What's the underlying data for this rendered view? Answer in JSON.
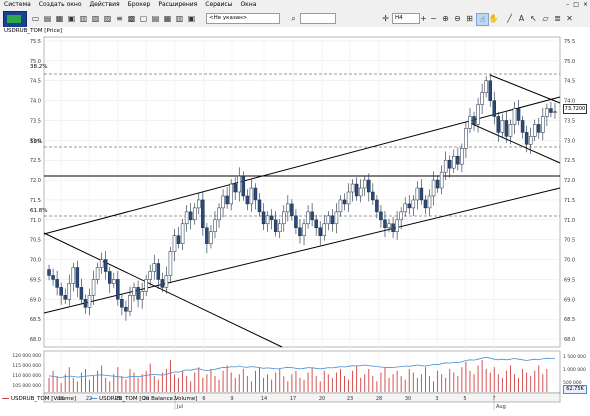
{
  "menu": [
    "Система",
    "Создать окно",
    "Действия",
    "Брокер",
    "Расширения",
    "Сервисы",
    "Окна"
  ],
  "window_controls": [
    "–",
    "□",
    "×"
  ],
  "toolbar": {
    "account_select": "<Не указан>",
    "timeframe": "H4",
    "search_placeholder": ""
  },
  "price_pane": {
    "title": "USDRUB_TOM [Price]",
    "current_price": "73.7200",
    "fib_labels": [
      "38.2%",
      "50%",
      "61.8%"
    ],
    "y_ticks": [
      "75.5",
      "75.0",
      "74.5",
      "74.0",
      "73.5",
      "73.0",
      "72.5",
      "72.0",
      "71.5",
      "71.0",
      "70.5",
      "70.0",
      "69.5",
      "69.0",
      "68.5",
      "68.0"
    ]
  },
  "volume_pane": {
    "left_ticks": [
      "120 000 000",
      "115 000 000",
      "110 000 000",
      "105 000 000"
    ],
    "right_ticks": [
      "1 500 000",
      "1 000 000",
      "500 000"
    ],
    "obv_value": "62.75K",
    "legend": [
      {
        "label": "USDRUB_TOM [Volume]",
        "color": "#d04040"
      },
      {
        "label": "USDRUB_TOM [On Balance Volume]",
        "color": "#4a90d0"
      }
    ]
  },
  "x_axis": {
    "day_labels": [
      "18",
      "22",
      "25",
      "29",
      "2",
      "6",
      "9",
      "14",
      "17",
      "20",
      "23",
      "28",
      "30",
      "3",
      "5",
      "7"
    ],
    "month_labels": [
      "Jul",
      "Aug"
    ]
  },
  "colors": {
    "up": "#ffffff",
    "down": "#2a4a7a",
    "border": "#1a2a40",
    "volume": "#d04040",
    "obv": "#4a90d0"
  },
  "chart_data": {
    "type": "candlestick",
    "title": "USDRUB_TOM [Price]",
    "ylim": [
      67.8,
      75.6
    ],
    "closes": [
      69.6,
      69.5,
      69.3,
      69.1,
      69.0,
      69.4,
      69.8,
      69.3,
      69.0,
      68.8,
      69.1,
      69.5,
      69.8,
      70.0,
      69.7,
      69.4,
      69.5,
      69.0,
      68.8,
      68.7,
      69.1,
      69.3,
      69.0,
      69.2,
      69.5,
      69.7,
      69.9,
      69.5,
      69.3,
      69.6,
      70.2,
      70.6,
      70.4,
      70.9,
      71.2,
      71.0,
      71.3,
      71.5,
      70.8,
      70.4,
      70.7,
      71.0,
      71.3,
      71.6,
      71.4,
      71.9,
      71.7,
      72.1,
      71.6,
      71.4,
      71.8,
      71.5,
      71.2,
      70.9,
      71.1,
      71.0,
      70.7,
      70.9,
      71.2,
      71.4,
      71.1,
      70.8,
      70.6,
      70.9,
      71.2,
      71.0,
      70.8,
      70.6,
      70.9,
      71.1,
      70.9,
      71.2,
      71.5,
      71.4,
      71.7,
      71.9,
      71.6,
      71.8,
      72.0,
      71.7,
      71.5,
      71.2,
      71.0,
      70.8,
      70.9,
      70.7,
      71.0,
      71.2,
      71.4,
      71.3,
      71.5,
      71.8,
      71.5,
      71.3,
      71.6,
      72.0,
      71.8,
      72.2,
      72.5,
      72.3,
      72.6,
      72.4,
      72.8,
      73.3,
      73.6,
      73.4,
      73.9,
      74.2,
      74.5,
      74.0,
      73.6,
      73.2,
      73.5,
      73.1,
      73.4,
      73.8,
      73.5,
      73.2,
      72.9,
      73.1,
      73.4,
      73.2,
      73.6,
      73.8,
      73.7,
      73.72
    ],
    "volume": [
      108,
      112,
      109,
      105,
      110,
      114,
      108,
      106,
      111,
      113,
      107,
      109,
      112,
      115,
      108,
      106,
      110,
      114,
      109,
      107,
      113,
      111,
      108,
      110,
      112,
      116,
      109,
      107,
      111,
      113,
      118,
      110,
      108,
      112,
      109,
      106,
      111,
      114,
      108,
      110,
      113,
      109,
      107,
      112,
      115,
      111,
      108,
      110,
      113,
      109,
      106,
      112,
      114,
      108,
      110,
      107,
      111,
      113,
      109,
      106,
      110,
      112,
      108,
      107,
      111,
      114,
      109,
      106,
      112,
      110,
      108,
      111,
      113,
      109,
      107,
      112,
      115,
      108,
      110,
      113,
      109,
      106,
      111,
      114,
      108,
      110,
      112,
      109,
      107,
      113,
      111,
      108,
      110,
      114,
      109,
      106,
      112,
      110,
      108,
      113,
      111,
      109,
      114,
      117,
      112,
      110,
      115,
      118,
      113,
      111,
      114,
      110,
      108,
      112,
      115,
      110,
      108,
      113,
      111,
      109,
      112,
      115,
      110,
      113
    ],
    "obv": [
      900,
      880,
      860,
      850,
      870,
      890,
      880,
      860,
      870,
      890,
      900,
      910,
      920,
      930,
      910,
      900,
      890,
      870,
      860,
      850,
      870,
      880,
      870,
      890,
      910,
      930,
      940,
      930,
      920,
      940,
      980,
      1020,
      1010,
      1050,
      1080,
      1070,
      1100,
      1120,
      1080,
      1060,
      1080,
      1100,
      1130,
      1160,
      1150,
      1180,
      1170,
      1200,
      1170,
      1160,
      1180,
      1170,
      1150,
      1130,
      1140,
      1130,
      1110,
      1120,
      1140,
      1160,
      1150,
      1130,
      1110,
      1130,
      1150,
      1140,
      1130,
      1110,
      1130,
      1150,
      1140,
      1160,
      1180,
      1170,
      1190,
      1210,
      1200,
      1210,
      1230,
      1210,
      1200,
      1180,
      1170,
      1150,
      1160,
      1150,
      1170,
      1180,
      1200,
      1190,
      1210,
      1230,
      1210,
      1200,
      1220,
      1250,
      1240,
      1270,
      1300,
      1290,
      1310,
      1300,
      1330,
      1370,
      1390,
      1380,
      1410,
      1440,
      1470,
      1440,
      1410,
      1390,
      1410,
      1390,
      1410,
      1430,
      1410,
      1390,
      1370,
      1390,
      1410,
      1400,
      1420,
      1440,
      1430,
      1435
    ]
  }
}
